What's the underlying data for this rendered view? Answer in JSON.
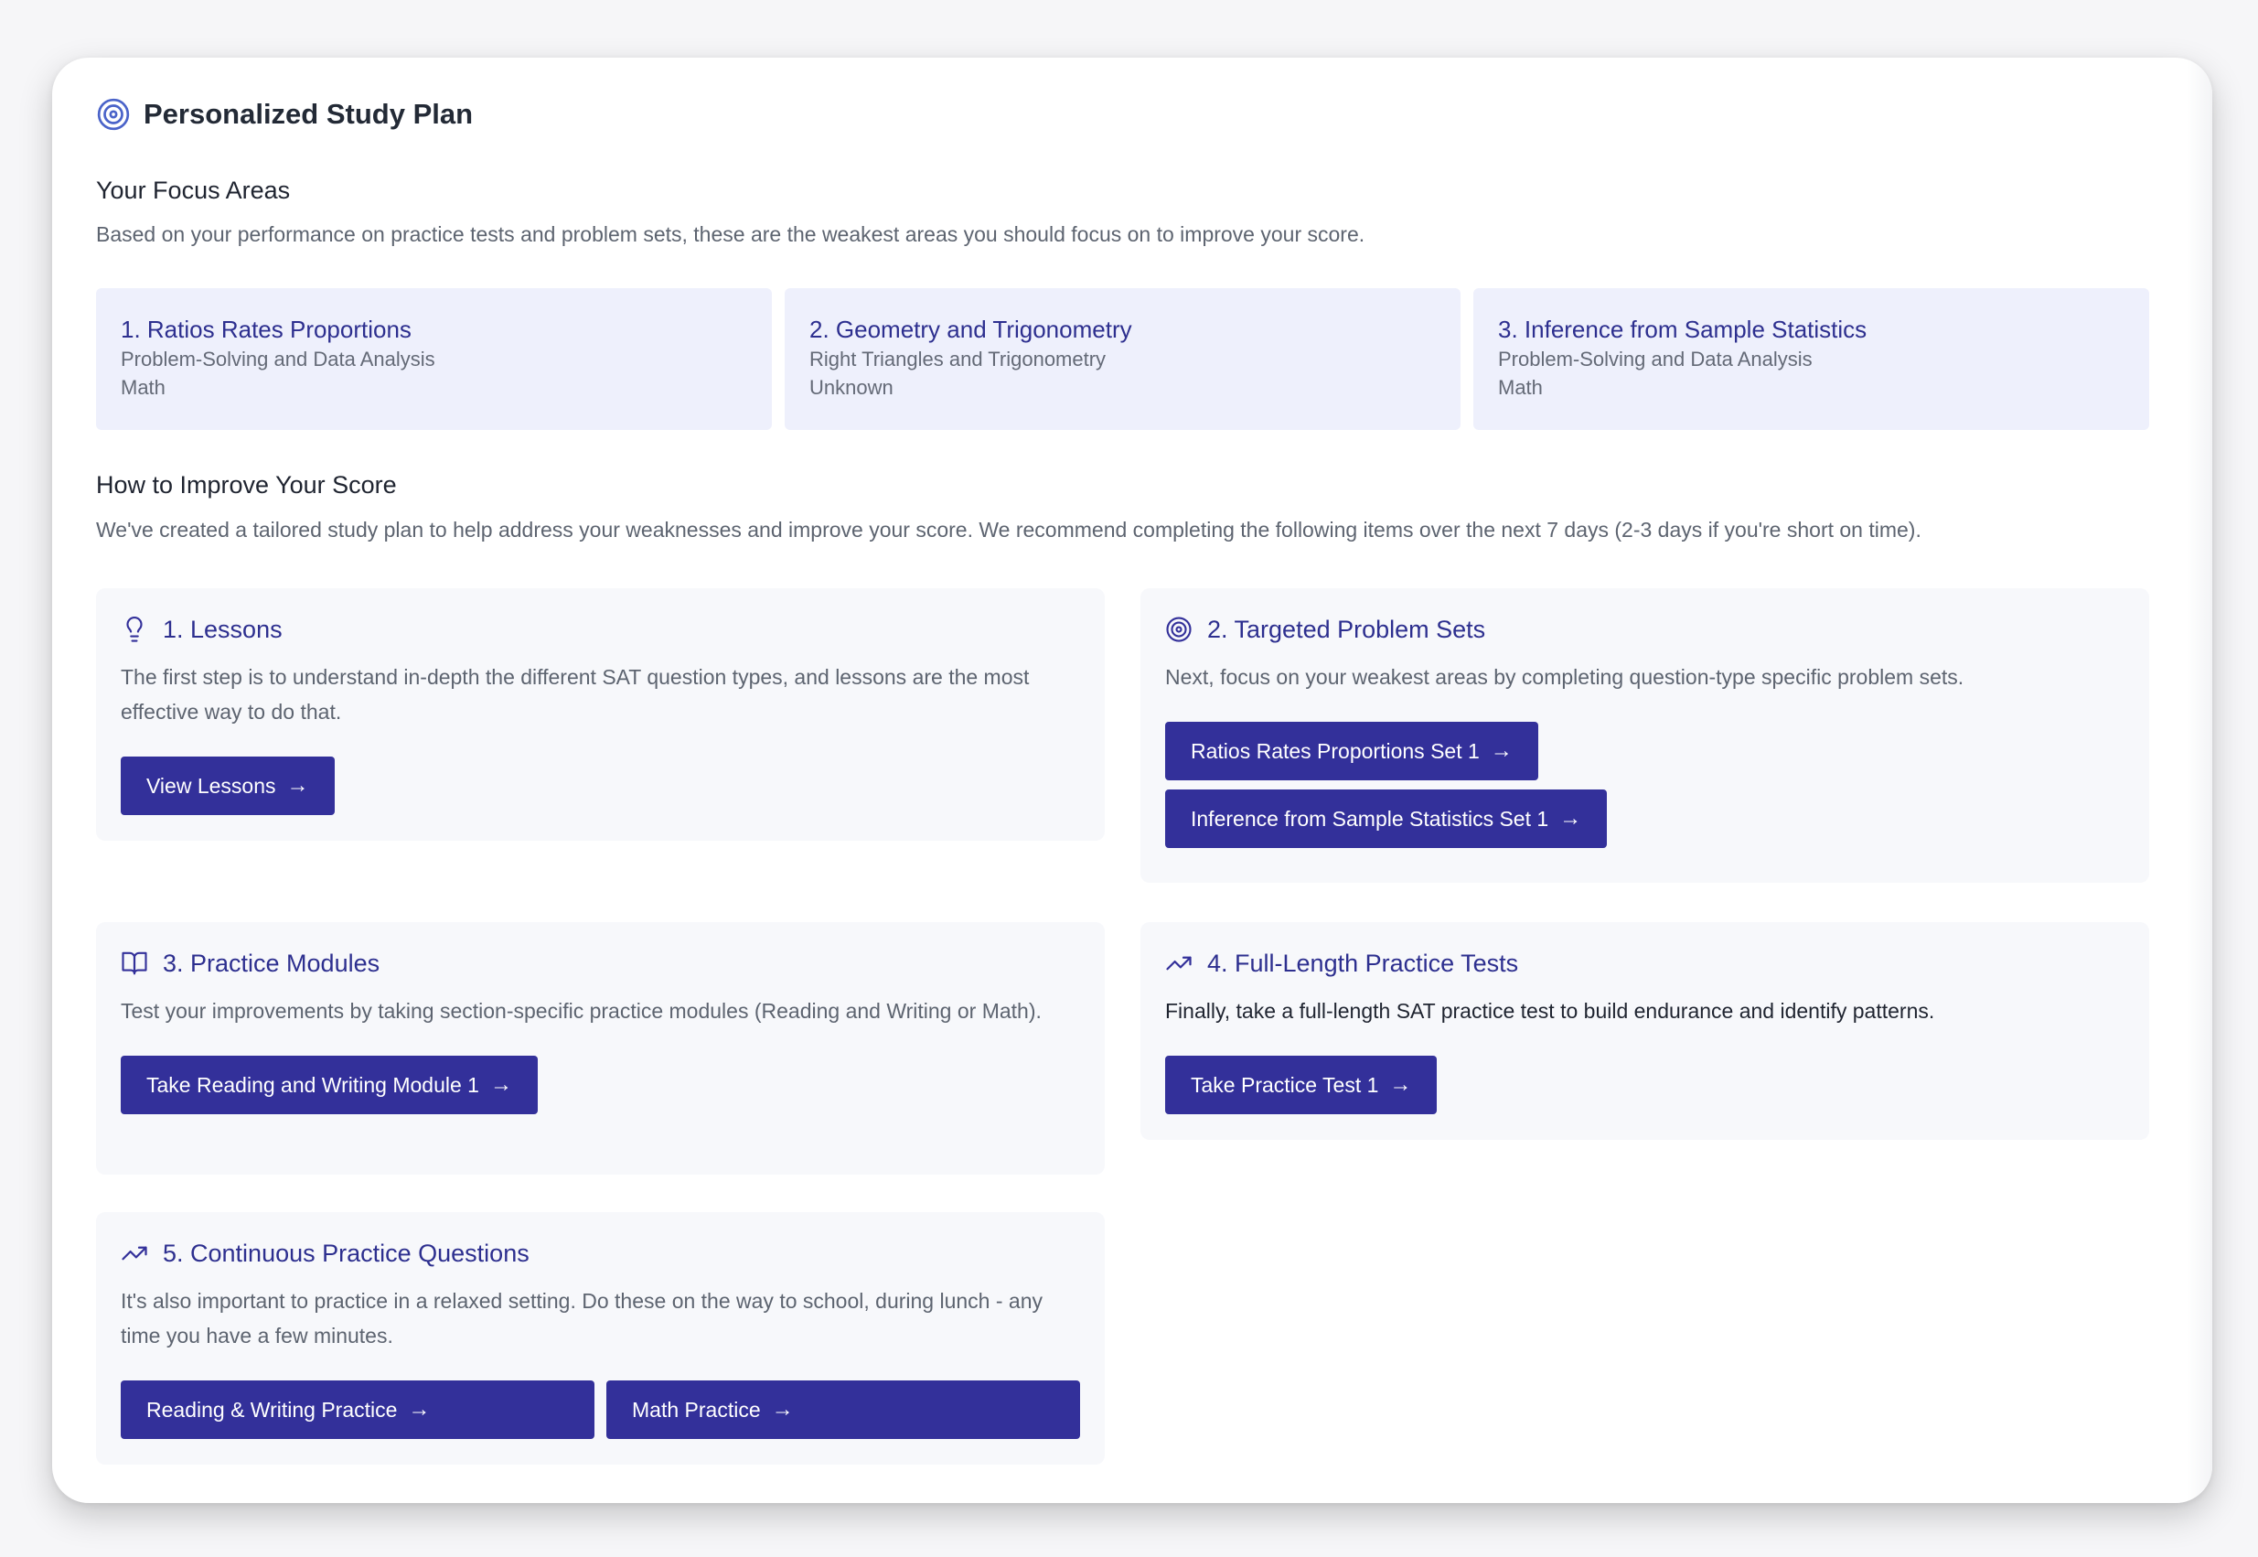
{
  "page": {
    "title": "Personalized Study Plan",
    "title_icon": "target-icon",
    "accent_color": "#33309a",
    "focus_card_bg": "#eef0fc"
  },
  "focus": {
    "heading": "Your Focus Areas",
    "description": "Based on your performance on practice tests and problem sets, these are the weakest areas you should focus on to improve your score.",
    "cards": [
      {
        "title": "1. Ratios Rates Proportions",
        "domain": "Problem-Solving and Data Analysis",
        "section": "Math"
      },
      {
        "title": "2. Geometry and Trigonometry",
        "domain": "Right Triangles and Trigonometry",
        "section": "Unknown"
      },
      {
        "title": "3. Inference from Sample Statistics",
        "domain": "Problem-Solving and Data Analysis",
        "section": "Math"
      }
    ]
  },
  "improve": {
    "heading": "How to Improve Your Score",
    "description": "We've created a tailored study plan to help address your weaknesses and improve your score. We recommend completing the following items over the next 7 days (2-3 days if you're short on time).",
    "steps": {
      "lessons": {
        "icon": "lightbulb-icon",
        "title": "1. Lessons",
        "description": "The first step is to understand in-depth the different SAT question types, and lessons are the most effective way to do that.",
        "buttons": [
          "View Lessons"
        ]
      },
      "problem_sets": {
        "icon": "target-icon",
        "title": "2. Targeted Problem Sets",
        "description": "Next, focus on your weakest areas by completing question-type specific problem sets.",
        "buttons": [
          "Ratios Rates Proportions Set 1",
          "Inference from Sample Statistics Set 1"
        ]
      },
      "modules": {
        "icon": "book-open-icon",
        "title": "3. Practice Modules",
        "description": "Test your improvements by taking section-specific practice modules (Reading and Writing or Math).",
        "buttons": [
          "Take Reading and Writing Module 1"
        ]
      },
      "tests": {
        "icon": "trending-up-icon",
        "title": "4. Full-Length Practice Tests",
        "description": "Finally, take a full-length SAT practice test to build endurance and identify patterns.",
        "buttons": [
          "Take Practice Test 1"
        ]
      },
      "continuous": {
        "icon": "trending-up-icon",
        "title": "5. Continuous Practice Questions",
        "description": "It's also important to practice in a relaxed setting. Do these on the way to school, during lunch - any time you have a few minutes.",
        "buttons": [
          "Reading & Writing Practice",
          "Math Practice"
        ]
      }
    }
  }
}
